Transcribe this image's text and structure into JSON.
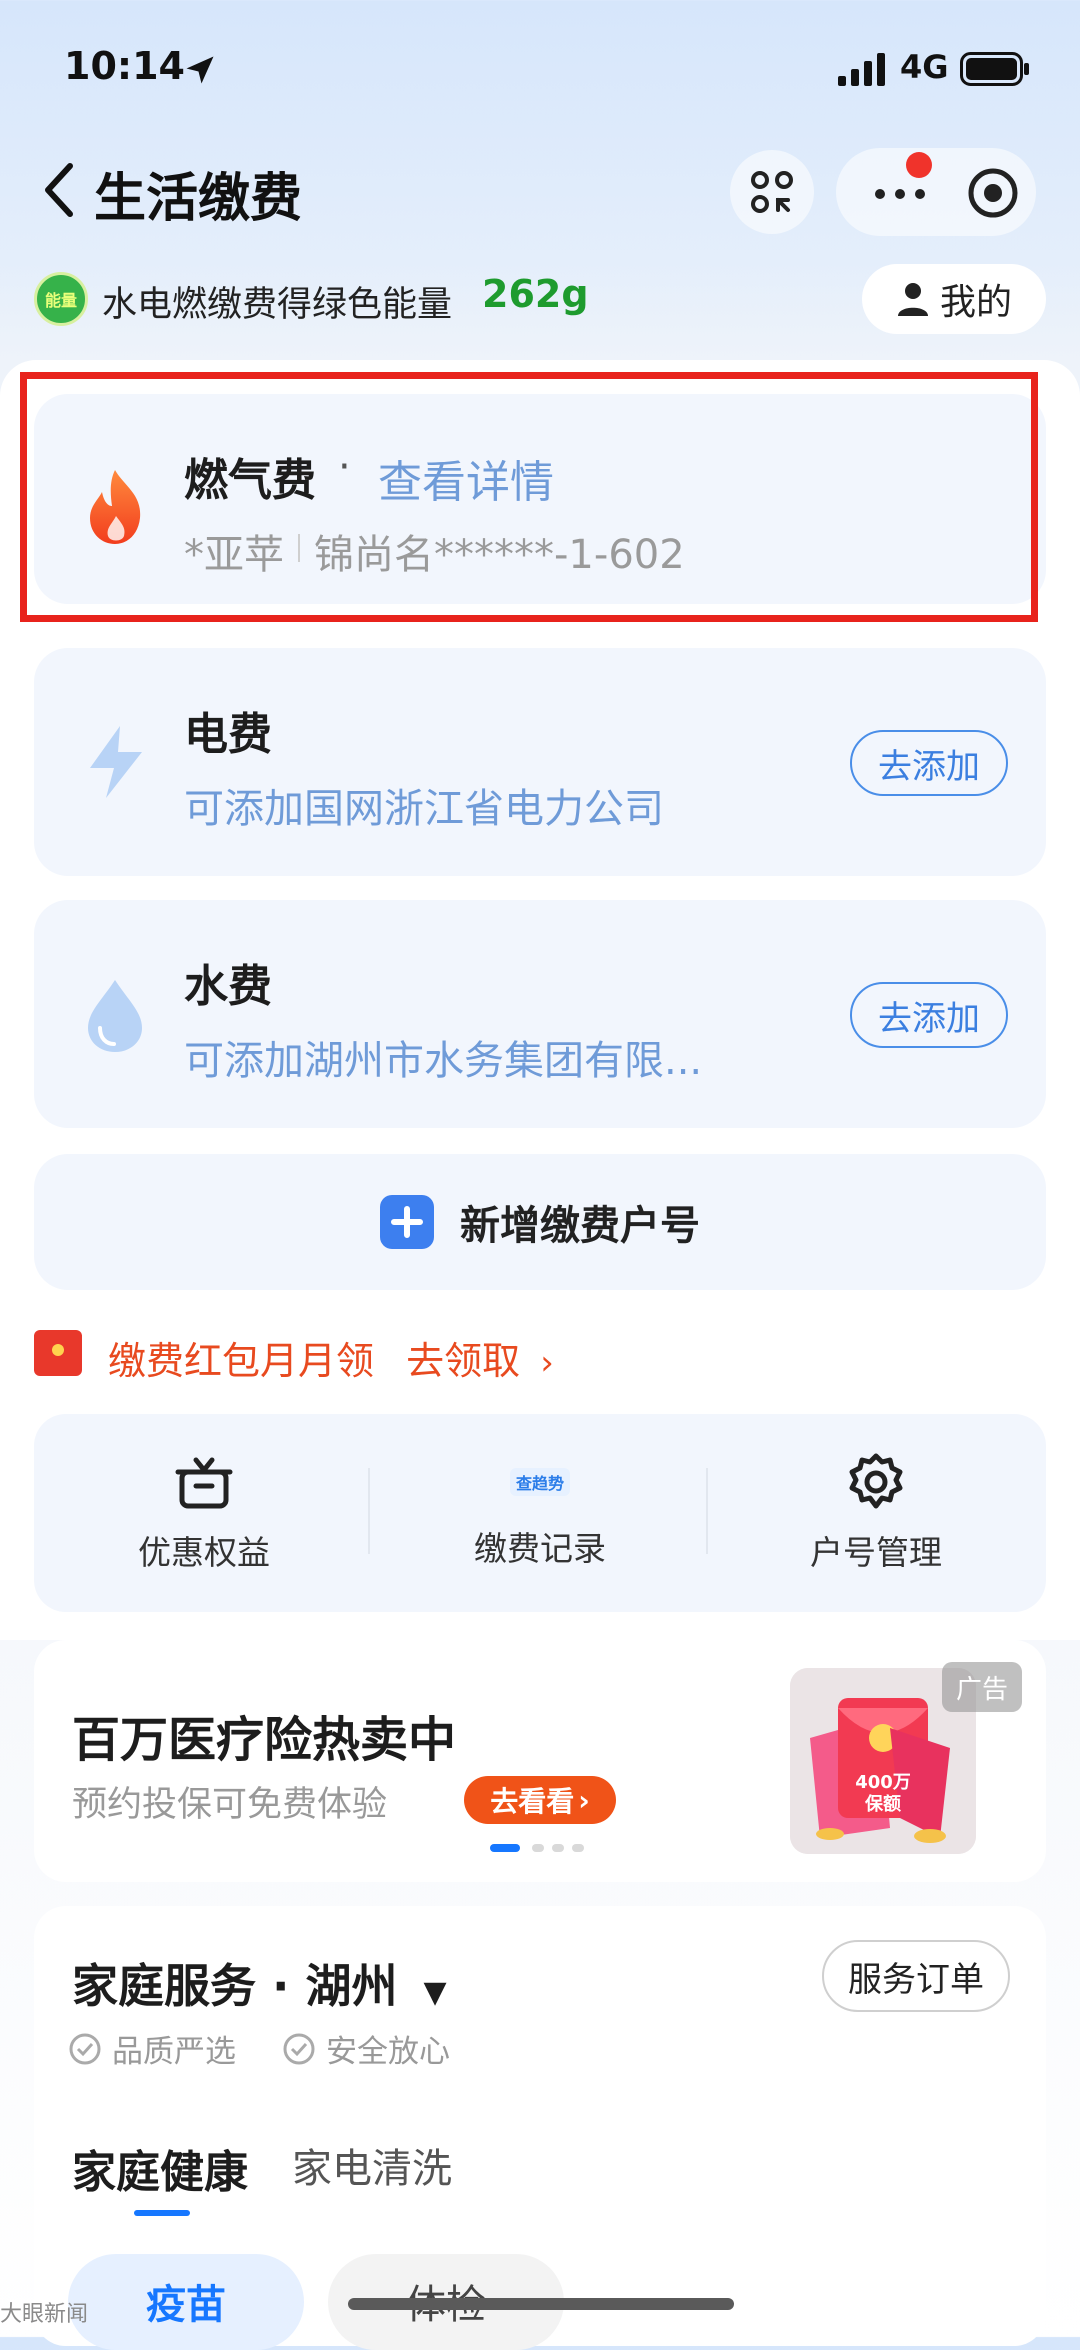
{
  "status_bar": {
    "time": "10:14",
    "network": "4G"
  },
  "nav": {
    "title": "生活缴费"
  },
  "energy": {
    "badge": "能量",
    "text": "水电燃缴费得绿色能量",
    "value": "262g",
    "mine_label": "我的"
  },
  "cards": {
    "gas": {
      "title": "燃气费",
      "dot": "·",
      "link": "查看详情",
      "name": "*亚苹",
      "address": "锦尚名******-1-602"
    },
    "electric": {
      "title": "电费",
      "sub": "可添加国网浙江省电力公司",
      "button": "去添加"
    },
    "water": {
      "title": "水费",
      "sub": "可添加湖州市水务集团有限...",
      "button": "去添加"
    },
    "new_account": {
      "label": "新增缴费户号"
    }
  },
  "promo": {
    "text": "缴费红包月月领",
    "link": "去领取"
  },
  "tools": [
    {
      "label": "优惠权益",
      "icon": "gift-icon"
    },
    {
      "label": "缴费记录",
      "icon": "record-icon",
      "badge": "查趋势"
    },
    {
      "label": "户号管理",
      "icon": "gear-icon"
    }
  ],
  "ad": {
    "title": "百万医疗险热卖中",
    "subtitle": "预约投保可免费体验",
    "button": "去看看",
    "tag": "广告",
    "image_text": "400万 保额"
  },
  "home_services": {
    "title": "家庭服务 · 湖州",
    "order_button": "服务订单",
    "checks": [
      "品质严选",
      "安全放心"
    ],
    "tabs": [
      "家庭健康",
      "家电清洗"
    ],
    "chips": [
      "疫苗",
      "体检"
    ]
  },
  "watermark": "大眼新闻",
  "colors": {
    "accent": "#1677ff",
    "highlight": "#e8231c",
    "energy_green": "#1e9b2e",
    "promo": "#e84a1f"
  }
}
